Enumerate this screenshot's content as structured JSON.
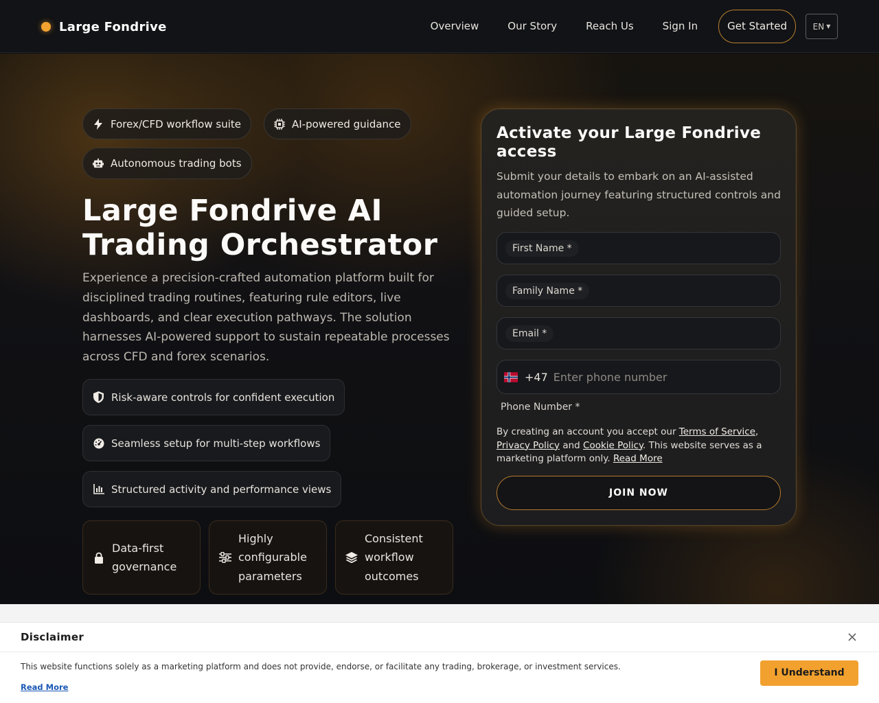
{
  "header": {
    "brand": "Large Fondrive",
    "nav": [
      "Overview",
      "Our Story",
      "Reach Us",
      "Sign In"
    ],
    "cta": "Get Started",
    "language": "EN",
    "accent_color": "#f3a330"
  },
  "hero": {
    "pills": [
      "Forex/CFD workflow suite",
      "AI-powered guidance",
      "Autonomous trading bots"
    ],
    "title": "Large Fondrive AI Trading Orchestrator",
    "description": "Experience a precision-crafted automation platform built for disciplined trading routines, featuring rule editors, live dashboards, and clear execution pathways. The solution harnesses AI-powered support to sustain repeatable processes across CFD and forex scenarios.",
    "features": [
      "Risk-aware controls for confident execution",
      "Seamless setup for multi-step workflows",
      "Structured activity and performance views"
    ],
    "cards": [
      "Data-first governance",
      "Highly configurable parameters",
      "Consistent workflow outcomes"
    ]
  },
  "form": {
    "title": "Activate your Large Fondrive access",
    "subtitle": "Submit your details to embark on an AI-assisted automation journey featuring structured controls and guided setup.",
    "first_name_label": "First Name *",
    "family_name_label": "Family Name *",
    "email_label": "Email *",
    "dial_code": "+47",
    "phone_placeholder": "Enter phone number",
    "phone_label": "Phone Number *",
    "terms_prefix": "By creating an account you accept our",
    "terms_link": "Terms of Service",
    "privacy_link": "Privacy Policy",
    "and": "and",
    "cookie_link": "Cookie Policy",
    "terms_suffix": ". This website serves as a marketing platform only.",
    "read_more": "Read More",
    "submit": "JOIN NOW"
  },
  "disclaimer": {
    "title": "Disclaimer",
    "text": "This website functions solely as a marketing platform and does not provide, endorse, or facilitate any trading, brokerage, or investment services.",
    "read_more": "Read More",
    "button": "I Understand"
  }
}
